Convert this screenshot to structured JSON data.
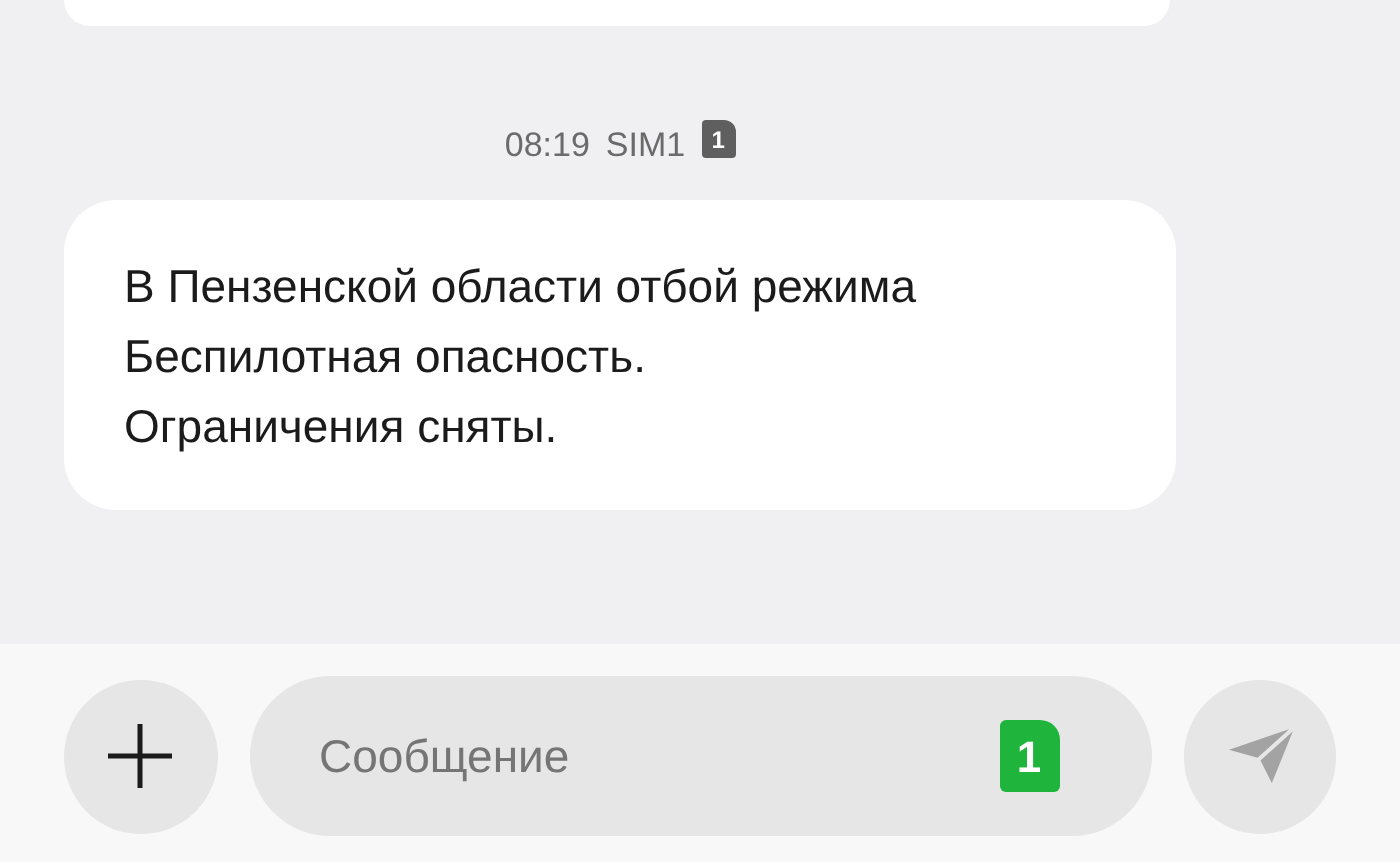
{
  "timestamp": {
    "time": "08:19",
    "sim": "SIM1",
    "sim_slot": "1"
  },
  "messages": [
    {
      "text": "В Пензенской области отбой режима\nБеспилотная опасность.\nОграничения сняты."
    }
  ],
  "composer": {
    "placeholder": "Сообщение",
    "sim_slot": "1",
    "send_enabled": false
  }
}
